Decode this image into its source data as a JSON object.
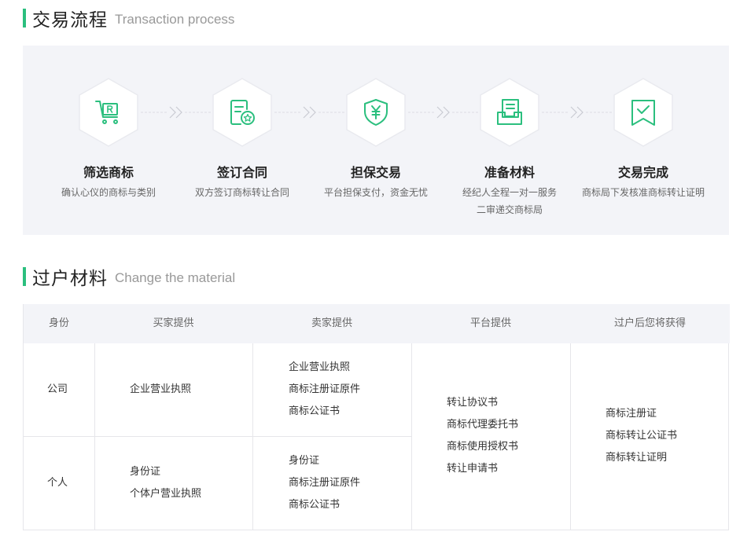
{
  "process": {
    "title_zh": "交易流程",
    "title_en": "Transaction process",
    "steps": [
      {
        "icon": "cart-r-icon",
        "title": "筛选商标",
        "desc": [
          "确认心仪的商标与类别"
        ]
      },
      {
        "icon": "contract-icon",
        "title": "签订合同",
        "desc": [
          "双方签订商标转让合同"
        ]
      },
      {
        "icon": "shield-yen-icon",
        "title": "担保交易",
        "desc": [
          "平台担保支付，资金无忧"
        ]
      },
      {
        "icon": "documents-tray-icon",
        "title": "准备材料",
        "desc": [
          "经纪人全程一对一服务",
          "二审递交商标局"
        ]
      },
      {
        "icon": "check-badge-icon",
        "title": "交易完成",
        "desc": [
          "商标局下发核准商标转让证明"
        ]
      }
    ]
  },
  "materials": {
    "title_zh": "过户材料",
    "title_en": "Change the material",
    "headers": [
      "身份",
      "买家提供",
      "卖家提供",
      "平台提供",
      "过户后您将获得"
    ],
    "rows": [
      {
        "identity": "公司",
        "buyer": [
          "企业营业执照"
        ],
        "seller": [
          "企业营业执照",
          "商标注册证原件",
          "商标公证书"
        ]
      },
      {
        "identity": "个人",
        "buyer": [
          "身份证",
          "个体户营业执照"
        ],
        "seller": [
          "身份证",
          "商标注册证原件",
          "商标公证书"
        ]
      }
    ],
    "platform": [
      "转让协议书",
      "商标代理委托书",
      "商标使用授权书",
      "转让申请书"
    ],
    "obtain": [
      "商标注册证",
      "商标转让公证书",
      "商标转让证明"
    ]
  },
  "colors": {
    "accent": "#2bbf7e",
    "panel_bg": "#f3f4f8",
    "border": "#e6e6ea"
  }
}
